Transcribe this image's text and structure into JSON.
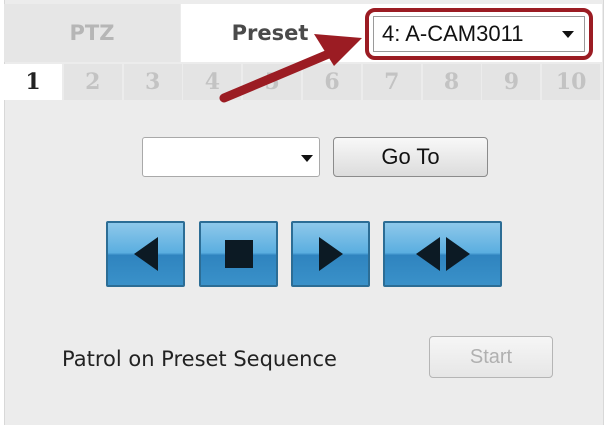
{
  "tabs": {
    "ptz_label": "PTZ",
    "preset_label": "Preset"
  },
  "camera_select": {
    "selected": "4: A-CAM3011"
  },
  "preset_numbers": [
    "1",
    "2",
    "3",
    "4",
    "5",
    "6",
    "7",
    "8",
    "9",
    "10"
  ],
  "active_preset_number": "1",
  "preset_select": {
    "selected": ""
  },
  "buttons": {
    "goto_label": "Go To",
    "start_label": "Start"
  },
  "patrol": {
    "label": "Patrol on Preset Sequence"
  },
  "colors": {
    "callout": "#9b1c23",
    "control_blue": "#3a91c9"
  },
  "icons": [
    "play-reverse-icon",
    "stop-icon",
    "play-forward-icon",
    "play-bidirectional-icon",
    "callout-arrow"
  ]
}
